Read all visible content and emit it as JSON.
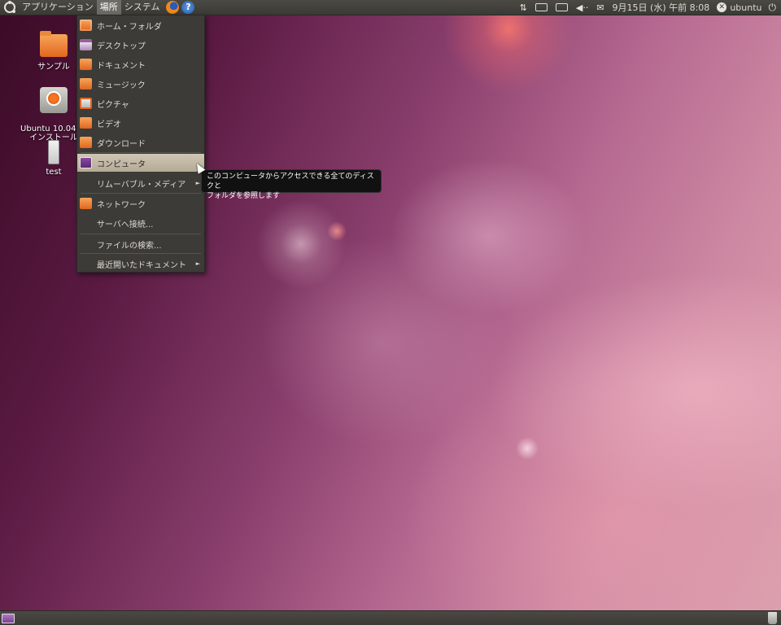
{
  "top_panel": {
    "menus": [
      "アプリケーション",
      "場所",
      "システム"
    ],
    "active_menu_index": 1,
    "launchers": [
      {
        "name": "firefox-icon"
      },
      {
        "name": "help-icon",
        "glyph": "?"
      }
    ],
    "tray": {
      "network_glyph": "⇅",
      "volume_glyph": "◀··",
      "mail_glyph": "✉",
      "clock": "9月15日 (水) 午前 8:08",
      "user_name": "ubuntu",
      "user_glyph": "✕",
      "power_glyph": "⏻"
    }
  },
  "desktop_icons": [
    {
      "label": "サンプル",
      "icon": "folder-icon"
    },
    {
      "label": "Ubuntu 10.04 LT\nインストール",
      "icon": "installer-icon"
    },
    {
      "label": "test",
      "icon": "usb-drive-icon"
    }
  ],
  "places_menu": {
    "items": [
      {
        "label": "ホーム・フォルダ",
        "icon": "home-folder-icon"
      },
      {
        "label": "デスクトップ",
        "icon": "desktop-folder-icon"
      },
      {
        "label": "ドキュメント",
        "icon": "documents-folder-icon"
      },
      {
        "label": "ミュージック",
        "icon": "music-folder-icon"
      },
      {
        "label": "ピクチャ",
        "icon": "pictures-folder-icon"
      },
      {
        "label": "ビデオ",
        "icon": "videos-folder-icon"
      },
      {
        "label": "ダウンロード",
        "icon": "downloads-folder-icon"
      },
      {
        "label": "コンピュータ",
        "icon": "computer-icon",
        "highlighted": true
      },
      {
        "label": "リムーバブル・メディア",
        "submenu": true
      },
      {
        "label": "ネットワーク",
        "icon": "network-icon"
      },
      {
        "label": "サーバへ接続..."
      },
      {
        "label": "ファイルの検索..."
      },
      {
        "label": "最近開いたドキュメント",
        "submenu": true
      }
    ],
    "submenu_arrow": "►"
  },
  "tooltip": {
    "line1": "このコンピュータからアクセスできる全てのディスクと",
    "line2": "フォルダを参照します"
  },
  "bottom_panel": {
    "show_desktop": "show-desktop-icon",
    "trash": "trash-icon"
  },
  "colors": {
    "panel": "#3c3b37",
    "menu_highlight": "#c2b8a3",
    "accent_orange": "#e2661f"
  }
}
